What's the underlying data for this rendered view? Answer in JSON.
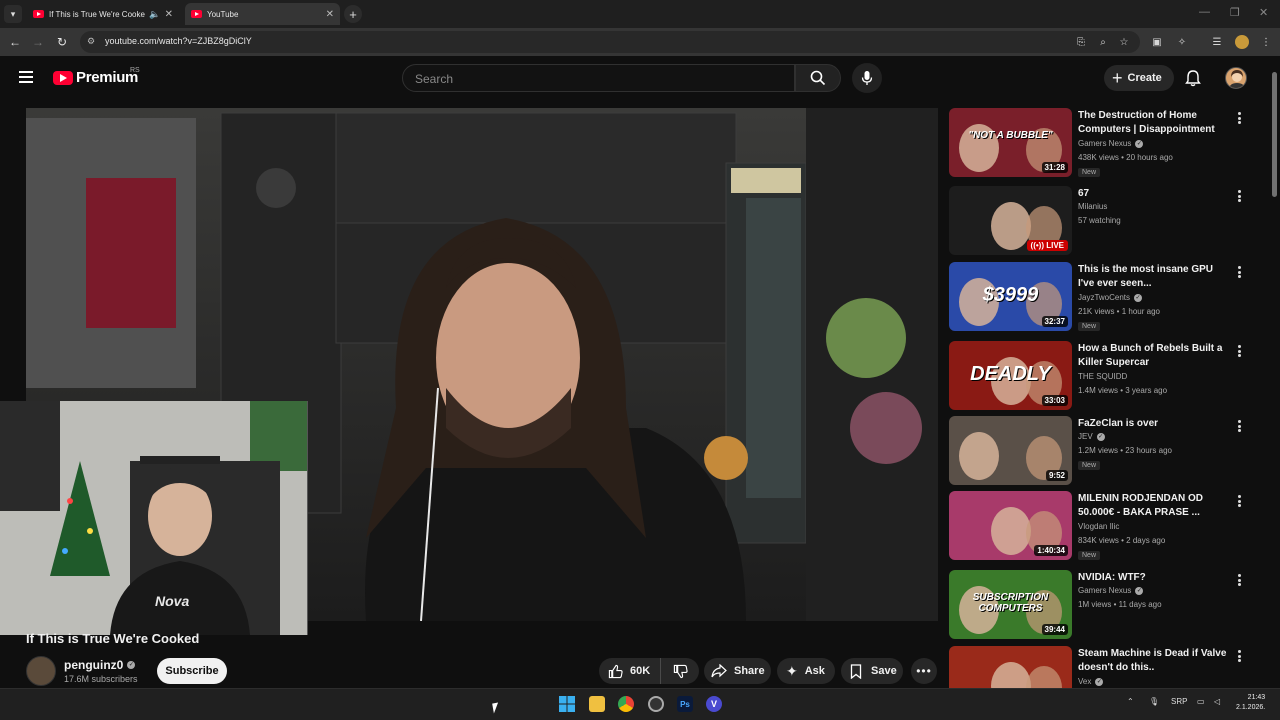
{
  "browser": {
    "tabs": [
      {
        "label": "If This is True We're Cooked"
      },
      {
        "label": "YouTube"
      }
    ],
    "url": "youtube.com/watch?v=ZJBZ8gDiClY"
  },
  "masthead": {
    "logo_text": "Premium",
    "country_code": "RS",
    "search_placeholder": "Search",
    "create_label": "Create"
  },
  "video": {
    "title": "If This is True We're Cooked",
    "channel_name": "penguinz0",
    "subscribers": "17.6M subscribers",
    "subscribe_label": "Subscribe",
    "like_count": "60K",
    "share_label": "Share",
    "ask_label": "Ask",
    "save_label": "Save"
  },
  "recommendations": [
    {
      "title": "The Destruction of Home Computers | Disappointment P...",
      "channel": "Gamers Nexus",
      "verified": true,
      "meta": "438K views • 20 hours ago",
      "new": "New",
      "duration": "31:28",
      "thumb_text": "\"NOT A BUBBLE\"",
      "thumb_color": "#7a1f2a"
    },
    {
      "title": "67",
      "channel": "Milanius",
      "verified": false,
      "meta": "57 watching",
      "new": "",
      "live": "LIVE",
      "thumb_color": "#1d1d1d"
    },
    {
      "title": "This is the most insane GPU I've ever seen...",
      "channel": "JayzTwoCents",
      "verified": true,
      "meta": "21K views • 1 hour ago",
      "new": "New",
      "duration": "32:37",
      "thumb_text": "$3999",
      "thumb_color": "#2a4aa8"
    },
    {
      "title": "How a Bunch of Rebels Built a Killer Supercar",
      "channel": "THE SQUIDD",
      "verified": false,
      "meta": "1.4M views • 3 years ago",
      "new": "",
      "duration": "33:03",
      "thumb_text": "DEADLY",
      "thumb_color": "#8a1a14"
    },
    {
      "title": "FaZeClan is over",
      "channel": "JEV",
      "verified": true,
      "meta": "1.2M views • 23 hours ago",
      "new": "New",
      "duration": "9:52",
      "thumb_color": "#5a5048"
    },
    {
      "title": "MILENIN RODJENDAN OD 50.000€ - BAKA PRASE ...",
      "channel": "Vlogdan Ilic",
      "verified": false,
      "meta": "834K views • 2 days ago",
      "new": "New",
      "duration": "1:40:34",
      "thumb_color": "#a83a6a"
    },
    {
      "title": "NVIDIA: WTF?",
      "channel": "Gamers Nexus",
      "verified": true,
      "meta": "1M views • 11 days ago",
      "new": "",
      "duration": "39:44",
      "thumb_text": "SUBSCRIPTION COMPUTERS",
      "thumb_color": "#3a7a2a"
    },
    {
      "title": "Steam Machine is Dead if Valve doesn't do this..",
      "channel": "Vex",
      "verified": true,
      "meta": "",
      "new": "",
      "thumb_color": "#9a2a1a"
    }
  ],
  "taskbar": {
    "lang": "SRP",
    "time": "21:43",
    "date": "2.1.2026."
  }
}
